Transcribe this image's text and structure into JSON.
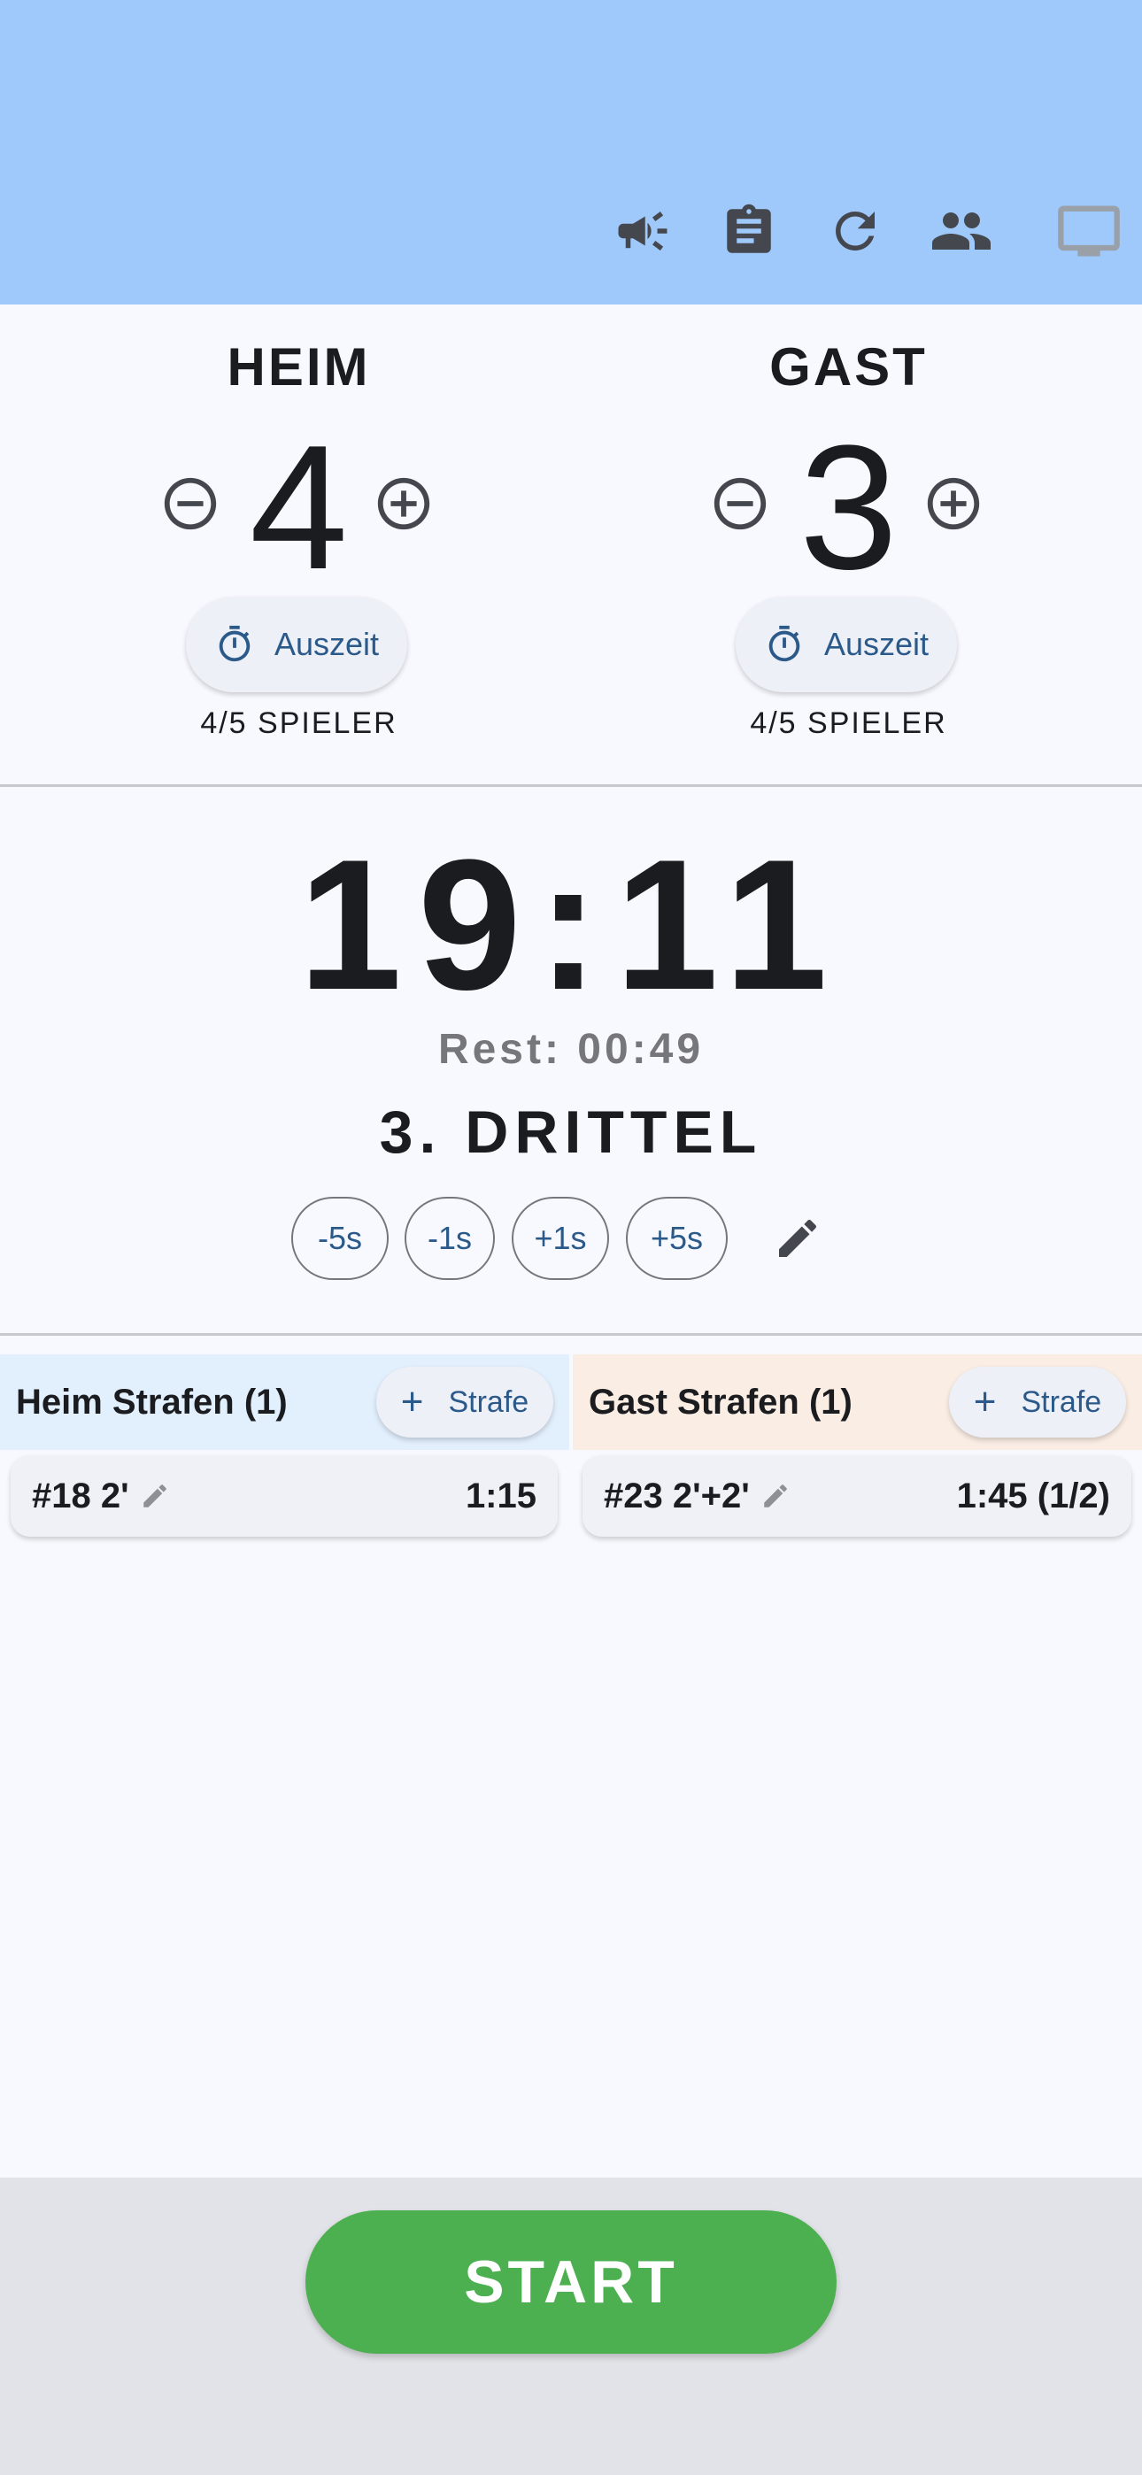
{
  "toolbar": {
    "icons": [
      "megaphone-icon",
      "clipboard-icon",
      "refresh-icon",
      "people-icon",
      "monitor-icon"
    ]
  },
  "home": {
    "name": "HEIM",
    "score": "4",
    "timeout_label": "Auszeit",
    "players": "4/5 SPIELER"
  },
  "guest": {
    "name": "GAST",
    "score": "3",
    "timeout_label": "Auszeit",
    "players": "4/5 SPIELER"
  },
  "clock": {
    "time": "19:11",
    "rest": "Rest: 00:49",
    "period": "3. DRITTEL",
    "adjust": [
      "-5s",
      "-1s",
      "+1s",
      "+5s"
    ]
  },
  "penalties": {
    "home": {
      "title": "Heim Strafen (1)",
      "add_label": "Strafe",
      "items": [
        {
          "label": "#18 2'",
          "time": "1:15"
        }
      ]
    },
    "guest": {
      "title": "Gast Strafen (1)",
      "add_label": "Strafe",
      "items": [
        {
          "label": "#23 2'+2'",
          "time": "1:45 (1/2)"
        }
      ]
    }
  },
  "start_label": "START",
  "colors": {
    "appbar": "#9fc8fb",
    "home_penalty_bg": "#e2effd",
    "guest_penalty_bg": "#faede4",
    "start_button": "#4caf50",
    "accent_text": "#2b5a8a"
  }
}
